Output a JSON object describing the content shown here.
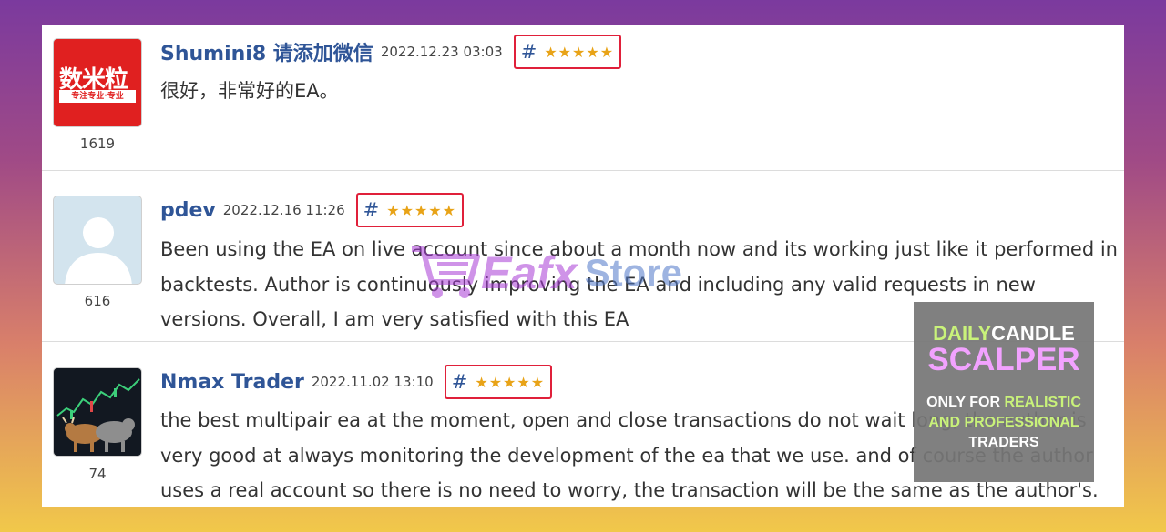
{
  "reviews": [
    {
      "user": "Shumini8 请添加微信",
      "date": "2022.12.23 03:03",
      "rating_symbol": "#",
      "stars": "★★★★★",
      "rating": 5,
      "count": "1619",
      "text": "很好，非常好的EA。",
      "avatar_text_top": "数米粒",
      "avatar_text_sub": "专注专业·专业"
    },
    {
      "user": "pdev",
      "date": "2022.12.16 11:26",
      "rating_symbol": "#",
      "stars": "★★★★★",
      "rating": 5,
      "count": "616",
      "text": "Been using the EA on live account since about a month now and its working just like it performed in backtests. Author is continuously improving the EA and including any valid requests in new versions. Overall, I am very satisfied with this EA"
    },
    {
      "user": "Nmax Trader",
      "date": "2022.11.02 13:10",
      "rating_symbol": "#",
      "stars": "★★★★★",
      "rating": 5,
      "count": "74",
      "text": "the best multipair ea at the moment, open and close transactions do not wait long, the author is very good at always monitoring the development of the ea that we use. and of course the author uses a real account so there is no need to worry, the transaction will be the same as the author's."
    }
  ],
  "watermark": {
    "name": "Eafx",
    "store": "Store"
  },
  "promo": {
    "line1_a": "DAILY",
    "line1_b": "CANDLE",
    "line2": "SCALPER",
    "line3_a": "ONLY FOR ",
    "line3_b": "REALISTIC",
    "line4": "AND PROFESSIONAL",
    "line5": "TRADERS"
  },
  "colors": {
    "username": "#2f5597",
    "rating_border": "#e0203a",
    "stars": "#e8a317",
    "promo_pink": "#f2a2ff",
    "promo_green": "#c9f27a"
  }
}
